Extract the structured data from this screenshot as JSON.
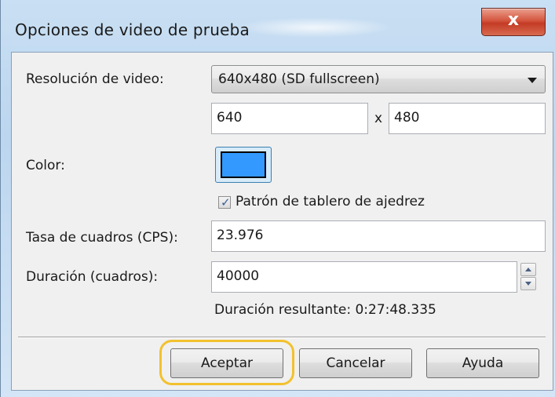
{
  "window": {
    "title": "Opciones de video de prueba",
    "close_glyph": "x"
  },
  "resolution": {
    "label": "Resolución de video:",
    "selected": "640x480 (SD fullscreen)",
    "width": "640",
    "height": "480",
    "separator": "x"
  },
  "color": {
    "label": "Color:",
    "value_hex": "#3399ff"
  },
  "checkerboard": {
    "label": "Patrón de tablero de ajedrez",
    "checked": true
  },
  "frame_rate": {
    "label": "Tasa de cuadros (CPS):",
    "value": "23.976"
  },
  "duration": {
    "label": "Duración (cuadros):",
    "value": "40000",
    "resulting_text": "Duración resultante: 0:27:48.335"
  },
  "buttons": {
    "ok": "Aceptar",
    "cancel": "Cancelar",
    "help": "Ayuda"
  },
  "colors": {
    "highlight_ring": "#f2c12e",
    "close_button": "#c33b25"
  }
}
